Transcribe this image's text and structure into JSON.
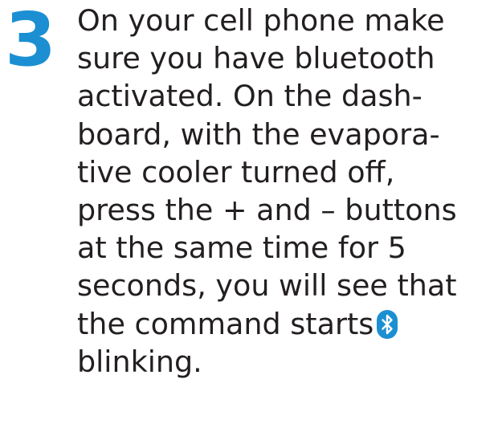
{
  "step": {
    "number": "3",
    "color": "#1b8fd2"
  },
  "instructions": {
    "lines": [
      "On your cell phone make",
      "sure you have bluetooth",
      "activated. On the dash-",
      "board, with the evapora-",
      "tive cooler turned off,",
      "press the + and – buttons",
      "at the same time for 5",
      "seconds, you will see that",
      "the command starts",
      "blinking."
    ],
    "inline_icon": "bluetooth-icon",
    "text_color": "#231f20"
  }
}
